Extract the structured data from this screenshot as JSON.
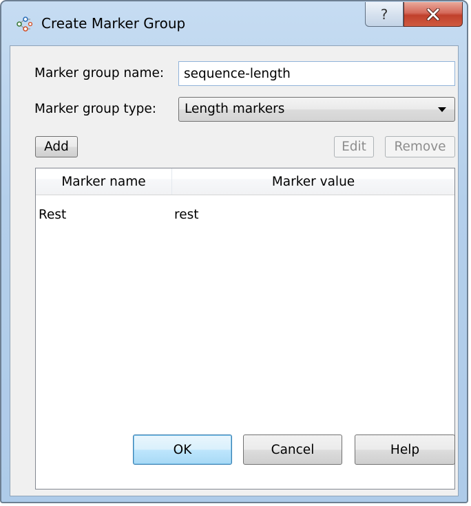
{
  "window": {
    "title": "Create Marker Group",
    "icon": "marker-group-icon",
    "help_glyph": "?",
    "help_icon": "help-icon",
    "close_icon": "close-icon",
    "close_color": "#c1402c"
  },
  "form": {
    "name_label": "Marker group name:",
    "name_value": "sequence-length",
    "type_label": "Marker group type:",
    "type_value": "Length markers"
  },
  "toolbar": {
    "add_label": "Add",
    "edit_label": "Edit",
    "remove_label": "Remove"
  },
  "table": {
    "columns": [
      "Marker name",
      "Marker value"
    ],
    "rows": [
      {
        "name": "Rest",
        "value": "rest"
      }
    ]
  },
  "footer": {
    "ok_label": "OK",
    "cancel_label": "Cancel",
    "help_label": "Help"
  }
}
